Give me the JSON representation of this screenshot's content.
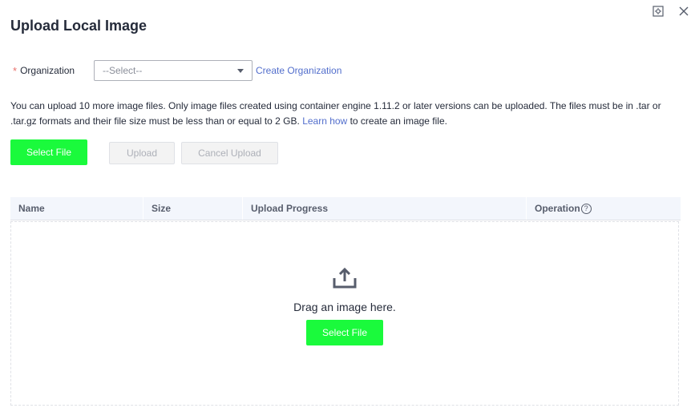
{
  "dialog": {
    "title": "Upload Local Image",
    "controls": [
      "settings-icon",
      "close-icon"
    ]
  },
  "organization": {
    "required_mark": "*",
    "label": "Organization",
    "selected_value": "--Select--",
    "create_link": "Create Organization"
  },
  "info": {
    "text_before_link": "You can upload 10 more image files. Only image files created using container engine 1.11.2 or later versions can be uploaded. The files must be in .tar or .tar.gz formats and their file size must be less than or equal to 2 GB.",
    "link_text": "Learn how",
    "text_after_link": "to create an image file."
  },
  "toolbar": {
    "select_file": "Select File",
    "upload": "Upload",
    "cancel_upload": "Cancel Upload"
  },
  "table": {
    "columns": [
      "Name",
      "Size",
      "Upload Progress",
      "Operation"
    ],
    "help_glyph": "?"
  },
  "dropzone": {
    "icon": "upload-icon",
    "text": "Drag an image here.",
    "select_file": "Select File"
  },
  "colors": {
    "primary": "#1afa3c",
    "link": "#526ecc",
    "required": "#e9706b",
    "header_bg": "#f3f6fc"
  }
}
